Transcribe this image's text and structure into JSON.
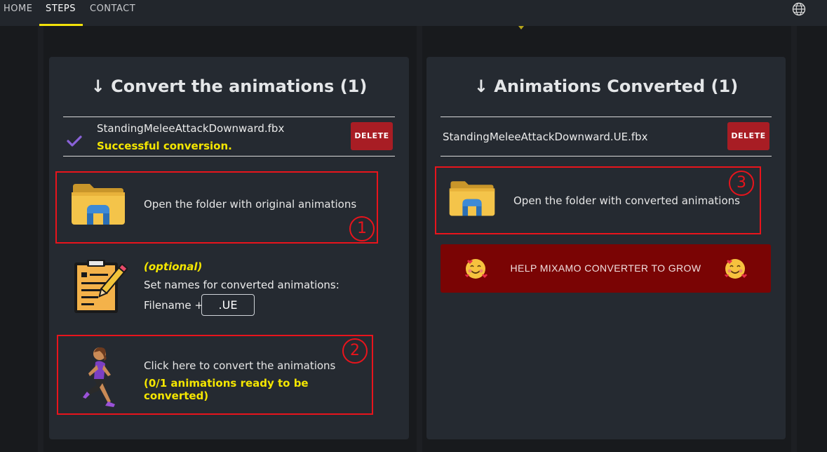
{
  "nav": {
    "items": [
      {
        "label": "HOME"
      },
      {
        "label": "STEPS",
        "active": true
      },
      {
        "label": "CONTACT"
      }
    ],
    "language_icon": "globe-icon"
  },
  "colors": {
    "accent_yellow": "#f4e600",
    "delete_red": "#a81d24",
    "annotation_red": "#e8141c",
    "help_button": "#7a0404"
  },
  "left_panel": {
    "title": "↓ Convert the animations (1)",
    "file": {
      "name": "StandingMeleeAttackDownward.fbx",
      "status": "Successful conversion.",
      "status_icon": "check-icon",
      "delete_label": "DELETE"
    },
    "open_folder": {
      "icon": "folder-icon",
      "label": "Open the folder with original animations",
      "step_number": "1"
    },
    "naming": {
      "icon": "edit-document-icon",
      "optional_label": "(optional)",
      "description": "Set names for converted animations:",
      "filename_label": "Filename +",
      "suffix_value": ".UE"
    },
    "convert": {
      "icon": "running-person-icon",
      "label": "Click here to convert the animations",
      "ready_text": "(0/1 animations ready to be converted)",
      "step_number": "2"
    }
  },
  "right_panel": {
    "title": "↓ Animations Converted (1)",
    "file": {
      "name": "StandingMeleeAttackDownward.UE.fbx",
      "delete_label": "DELETE"
    },
    "open_folder": {
      "icon": "folder-icon",
      "label": "Open the folder with converted animations",
      "step_number": "3"
    },
    "help_button": {
      "label": "HELP MIXAMO CONVERTER TO GROW",
      "icon": "smiling-face-with-hearts-icon"
    }
  }
}
